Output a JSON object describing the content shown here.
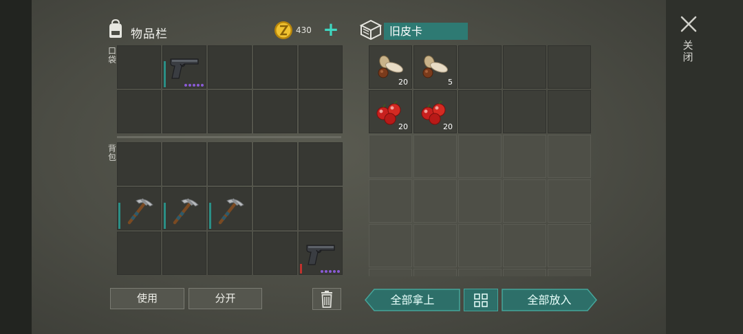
{
  "inventory": {
    "title": "物品栏",
    "coins": "430",
    "pocket_label": "口袋",
    "backpack_label": "背包",
    "pocket_slots": [
      {
        "item": null
      },
      {
        "item": "pistol",
        "purple_dots": 5,
        "durability_color": "#2a8f86"
      },
      {
        "item": null
      },
      {
        "item": null
      },
      {
        "item": null
      },
      {
        "item": null
      },
      {
        "item": null
      },
      {
        "item": null
      },
      {
        "item": null
      },
      {
        "item": null
      }
    ],
    "backpack_slots": [
      {
        "item": null
      },
      {
        "item": null
      },
      {
        "item": null
      },
      {
        "item": null
      },
      {
        "item": null
      },
      {
        "item": "pickaxe",
        "durability_color": "#2a8f86"
      },
      {
        "item": "pickaxe",
        "durability_color": "#2a8f86"
      },
      {
        "item": "pickaxe",
        "durability_color": "#2a8f86"
      },
      {
        "item": null
      },
      {
        "item": null
      },
      {
        "item": null
      },
      {
        "item": null
      },
      {
        "item": null
      },
      {
        "item": null
      },
      {
        "item": "pistol",
        "purple_dots": 5,
        "durability_color": "#c0322e"
      }
    ],
    "use_button": "使用",
    "split_button": "分开"
  },
  "container": {
    "name": "旧皮卡",
    "slots": [
      {
        "item": "seeds",
        "qty": "20"
      },
      {
        "item": "seeds",
        "qty": "5"
      },
      {
        "item": null
      },
      {
        "item": null
      },
      {
        "item": null
      },
      {
        "item": "berries",
        "qty": "20"
      },
      {
        "item": "berries",
        "qty": "20"
      },
      {
        "item": null
      },
      {
        "item": null
      },
      {
        "item": null
      }
    ],
    "take_all_button": "全部拿上",
    "put_all_button": "全部放入"
  },
  "close_label": "关闭",
  "colors": {
    "accent_teal": "#2e7a73",
    "plus_teal": "#3fd6c0",
    "rarity_purple": "#8a5bd6",
    "low_durability_red": "#c0322e"
  },
  "icons": [
    "backpack-icon",
    "coin-icon",
    "plus-icon",
    "box-icon",
    "close-icon",
    "pistol-icon",
    "pickaxe-icon",
    "seeds-icon",
    "berries-icon",
    "trash-icon",
    "layout-grid-icon"
  ]
}
